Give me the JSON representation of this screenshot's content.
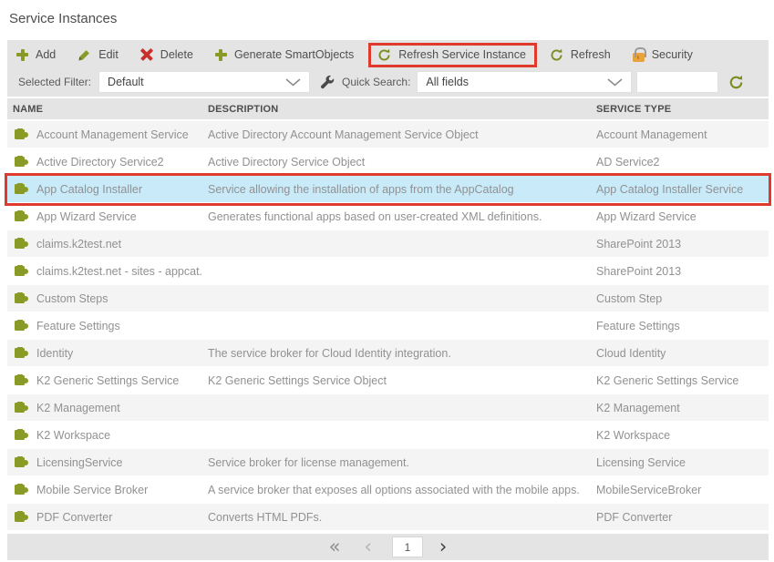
{
  "page": {
    "title": "Service Instances"
  },
  "toolbar": {
    "buttons": [
      {
        "label": "Add",
        "icon": "plus-icon"
      },
      {
        "label": "Edit",
        "icon": "pencil-icon"
      },
      {
        "label": "Delete",
        "icon": "delete-x-icon"
      },
      {
        "label": "Generate SmartObjects",
        "icon": "plus-icon"
      },
      {
        "label": "Refresh Service Instance",
        "icon": "refresh-icon",
        "highlighted": true
      },
      {
        "label": "Refresh",
        "icon": "refresh-icon"
      },
      {
        "label": "Security",
        "icon": "lock-icon"
      }
    ]
  },
  "filter_bar": {
    "selected_filter_label": "Selected Filter:",
    "selected_filter_value": "Default",
    "quick_search_label": "Quick Search:",
    "quick_search_value": "All fields",
    "search_value": ""
  },
  "table": {
    "columns": [
      "NAME",
      "DESCRIPTION",
      "SERVICE TYPE"
    ],
    "rows": [
      {
        "name": "Account Management Service",
        "description": "Active Directory Account Management Service Object",
        "type": "Account Management",
        "highlighted": false
      },
      {
        "name": "Active Directory Service2",
        "description": "Active Directory Service Object",
        "type": "AD Service2",
        "highlighted": false
      },
      {
        "name": "App Catalog Installer",
        "description": "Service allowing the installation of apps from the AppCatalog",
        "type": "App Catalog Installer Service",
        "highlighted": true
      },
      {
        "name": "App Wizard Service",
        "description": "Generates functional apps based on user-created XML definitions.",
        "type": "App Wizard Service",
        "highlighted": false
      },
      {
        "name": "claims.k2test.net",
        "description": "",
        "type": "SharePoint 2013",
        "highlighted": false
      },
      {
        "name": "claims.k2test.net - sites - appcat...",
        "description": "",
        "type": "SharePoint 2013",
        "highlighted": false
      },
      {
        "name": "Custom Steps",
        "description": "",
        "type": "Custom Step",
        "highlighted": false
      },
      {
        "name": "Feature Settings",
        "description": "",
        "type": "Feature Settings",
        "highlighted": false
      },
      {
        "name": "Identity",
        "description": "The service broker for Cloud Identity integration.",
        "type": "Cloud Identity",
        "highlighted": false
      },
      {
        "name": "K2 Generic Settings Service",
        "description": "K2 Generic Settings Service Object",
        "type": "K2 Generic Settings Service",
        "highlighted": false
      },
      {
        "name": "K2 Management",
        "description": "",
        "type": "K2 Management",
        "highlighted": false
      },
      {
        "name": "K2 Workspace",
        "description": "",
        "type": "K2 Workspace",
        "highlighted": false
      },
      {
        "name": "LicensingService",
        "description": "Service broker for license management.",
        "type": "Licensing Service",
        "highlighted": false
      },
      {
        "name": "Mobile Service Broker",
        "description": "A service broker that exposes all options associated with the mobile apps.",
        "type": "MobileServiceBroker",
        "highlighted": false
      },
      {
        "name": "PDF Converter",
        "description": "Converts HTML PDFs.",
        "type": "PDF Converter",
        "highlighted": false
      }
    ]
  },
  "pagination": {
    "first_icon": "«",
    "prev_icon": "‹",
    "next_icon": "›",
    "current_page": "1"
  },
  "colors": {
    "accent_green": "#8a9a26",
    "delete_red": "#c8312b",
    "callout_red": "#e0392e",
    "selected_row_blue": "#c9eaf9",
    "toolbar_gray": "#e4e4e4",
    "lock_orange": "#e8a33d"
  }
}
